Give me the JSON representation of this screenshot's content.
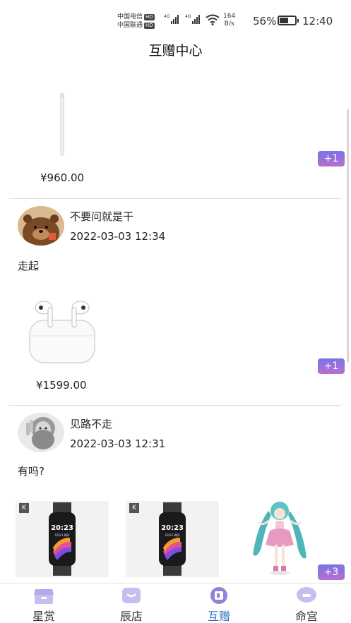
{
  "status_bar": {
    "carrier_1": "中国电信",
    "carrier_2": "中国联通",
    "hd_badge": "HD",
    "network_type": "4G",
    "net_speed_value": "164",
    "net_speed_unit": "B/s",
    "battery_percent": "56%",
    "battery_level": 0.56,
    "time": "12:40"
  },
  "header": {
    "title": "互赠中心"
  },
  "feed": [
    {
      "partial": true,
      "items": [
        "stylus-pen"
      ],
      "price": "¥960.00",
      "plus_count": "+1"
    },
    {
      "username": "不要问就是干",
      "time": "2022-03-03 12:34",
      "message": "走起",
      "items": [
        "airpods-pro"
      ],
      "price": "¥1599.00",
      "plus_count": "+1"
    },
    {
      "username": "见路不走",
      "time": "2022-03-03 12:31",
      "message": "有吗?",
      "items": [
        "smart-band",
        "smart-band",
        "anime-figure"
      ],
      "watch_time": "20:23",
      "watch_date": "03/23 周四",
      "brand_mark": "K",
      "plus_count": "+3"
    }
  ],
  "tabs": [
    {
      "label": "星赏",
      "icon": "box-icon",
      "active": false
    },
    {
      "label": "辰店",
      "icon": "store-icon",
      "active": false
    },
    {
      "label": "互赠",
      "icon": "gift-icon",
      "active": true
    },
    {
      "label": "命宫",
      "icon": "chat-icon",
      "active": false
    }
  ],
  "colors": {
    "accent": "#2a6fc9",
    "badge_top": "#7a74e6",
    "badge_bottom": "#b86ed0",
    "tab_icon": "#b4a9ea"
  }
}
